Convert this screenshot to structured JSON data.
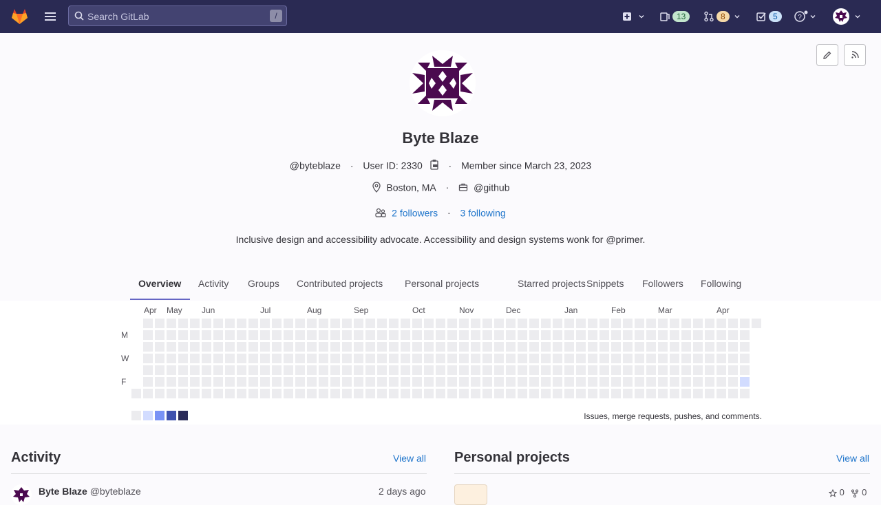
{
  "topbar": {
    "search_placeholder": "Search GitLab",
    "search_shortcut": "/",
    "issues_count": "13",
    "merge_requests_count": "8",
    "todos_count": "5"
  },
  "profile": {
    "name": "Byte Blaze",
    "username": "@byteblaze",
    "user_id": "User ID: 2330",
    "member_since": "Member since March 23, 2023",
    "location": "Boston, MA",
    "organization": "@github",
    "followers": "2 followers",
    "following": "3 following",
    "bio": "Inclusive design and accessibility advocate. Accessibility and design systems wonk for @primer."
  },
  "tabs": [
    "Overview",
    "Activity",
    "Groups",
    "Contributed projects",
    "Personal projects",
    "Starred projects",
    "Snippets",
    "Followers",
    "Following"
  ],
  "calendar": {
    "months": [
      "Apr",
      "May",
      "Jun",
      "Jul",
      "Aug",
      "Sep",
      "Oct",
      "Nov",
      "Dec",
      "Jan",
      "Feb",
      "Mar",
      "Apr"
    ],
    "days": [
      "M",
      "W",
      "F"
    ],
    "legend_text": "Issues, merge requests, pushes, and comments.",
    "legend_colors": [
      "#ececef",
      "#d2dcff",
      "#7992f5",
      "#3f51ae",
      "#2a2b59"
    ]
  },
  "activity": {
    "title": "Activity",
    "view_all": "View all",
    "item_name": "Byte Blaze",
    "item_username": "@byteblaze",
    "item_time": "2 days ago"
  },
  "projects": {
    "title": "Personal projects",
    "view_all": "View all",
    "stars": "0",
    "forks": "0"
  }
}
